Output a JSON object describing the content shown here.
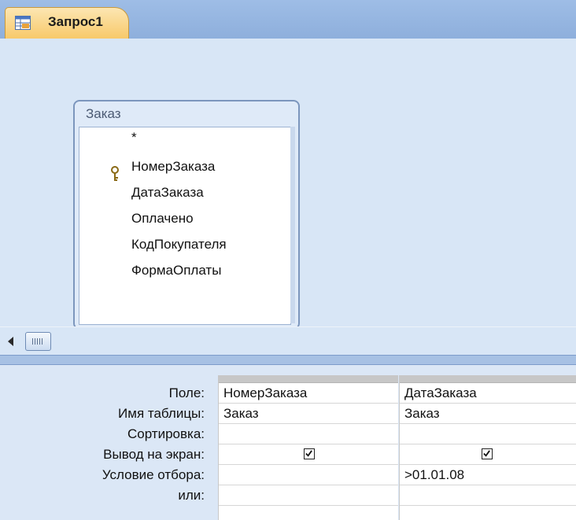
{
  "tab": {
    "label": "Запрос1",
    "icon": "query-icon"
  },
  "table": {
    "title": "Заказ",
    "fields": [
      "*",
      "НомерЗаказа",
      "ДатаЗаказа",
      "Оплачено",
      "КодПокупателя",
      "ФормаОплаты"
    ],
    "key_icon": "key-icon"
  },
  "grid": {
    "row_labels": [
      "Поле:",
      "Имя таблицы:",
      "Сортировка:",
      "Вывод на экран:",
      "Условие отбора:",
      "или:"
    ],
    "columns": [
      {
        "field": "НомерЗаказа",
        "table": "Заказ",
        "sort": "",
        "show": true,
        "criteria": "",
        "or": ""
      },
      {
        "field": "ДатаЗаказа",
        "table": "Заказ",
        "sort": "",
        "show": true,
        "criteria": ">01.01.08",
        "or": ""
      }
    ]
  },
  "colors": {
    "tab_active": "#f8c96a",
    "design_bg": "#d8e6f6",
    "splitter": "#a7c1e4"
  }
}
